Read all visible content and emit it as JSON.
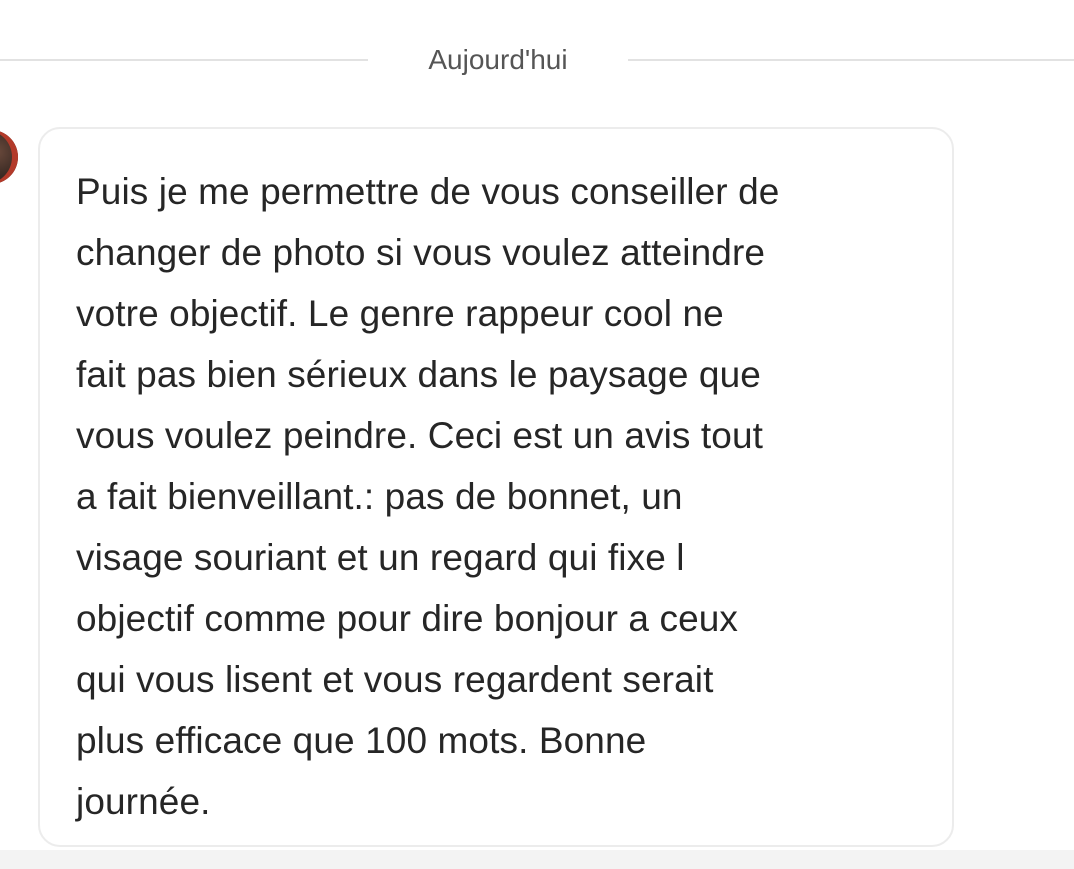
{
  "date_separator": {
    "label": "Aujourd'hui"
  },
  "message": {
    "sender_avatar_icon": "avatar-icon",
    "lines": [
      "Puis je me permettre de vous conseiller de",
      "changer de photo si vous voulez atteindre",
      "votre objectif. Le genre rappeur cool ne",
      "fait pas bien sérieux dans le paysage que",
      "vous voulez peindre. Ceci est un avis tout",
      "a fait bienveillant.: pas de bonnet, un",
      "visage souriant et un regard qui fixe l",
      "objectif comme pour dire bonjour a ceux",
      "qui vous lisent et vous regardent serait",
      "plus efficace que 100 mots. Bonne",
      "journée."
    ]
  }
}
